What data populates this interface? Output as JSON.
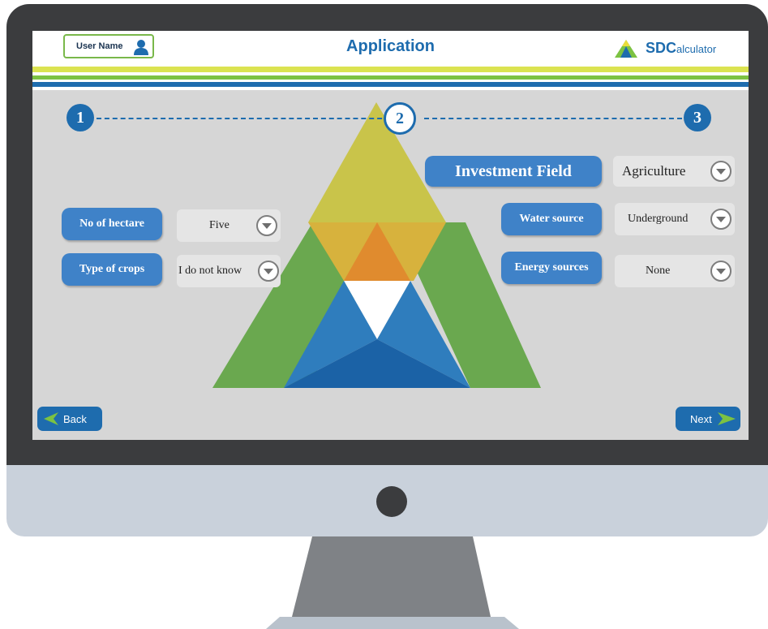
{
  "header": {
    "user_label": "User Name",
    "title": "Application",
    "logo_letters": "SDC",
    "logo_rest": "alculator"
  },
  "steps": [
    "1",
    "2",
    "3"
  ],
  "active_step": 2,
  "fields": {
    "investment_field": {
      "label": "Investment Field",
      "value": "Agriculture"
    },
    "water_source": {
      "label": "Water source",
      "value": "Underground"
    },
    "energy_sources": {
      "label": "Energy sources",
      "value": "None"
    },
    "hectares": {
      "label": "No of hectare",
      "value": "Five"
    },
    "crops": {
      "label": "Type of crops",
      "value": "I do not know"
    }
  },
  "nav": {
    "back_label": "Back",
    "next_label": "Next"
  },
  "colors": {
    "brand_blue": "#1e6cae",
    "pill_blue": "#3f82c8",
    "green": "#6aa84f",
    "yellow": "#c9c44a",
    "orange": "#e08b2e",
    "accent_green": "#7cc242",
    "stripe_yellow": "#dbe350"
  }
}
